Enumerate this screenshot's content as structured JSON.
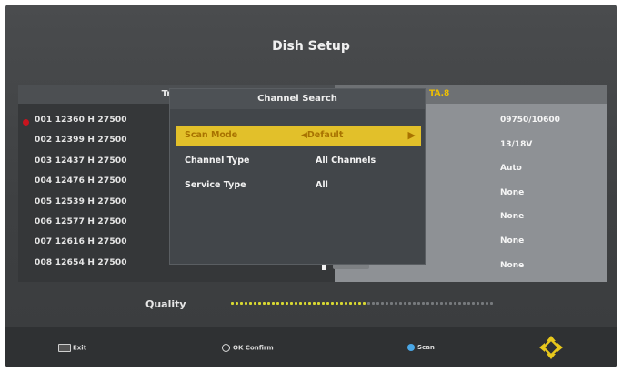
{
  "screen": {
    "title": "Dish Setup"
  },
  "transponder_panel": {
    "header": "Transf",
    "rows": [
      "001 12360 H 27500",
      "002 12399 H 27500",
      "003 12437 H 27500",
      "004 12476 H 27500",
      "005 12539 H 27500",
      "006 12577 H 27500",
      "007 12616 H 27500",
      "008 12654 H 27500"
    ]
  },
  "settings_panel": {
    "header_fragment": "TA.8",
    "values": [
      "09750/10600",
      "13/18V",
      "Auto",
      "None",
      "None",
      "None",
      "None"
    ],
    "last_value": "None"
  },
  "dialog": {
    "title": "Channel Search",
    "options": [
      {
        "label": "Scan Mode",
        "value": "Default",
        "selected": true
      },
      {
        "label": "Channel Type",
        "value": "All Channels",
        "selected": false
      },
      {
        "label": "Service Type",
        "value": "All",
        "selected": false
      }
    ],
    "left_arrow": "◀",
    "right_arrow": "▶"
  },
  "quality": {
    "label": "Quality",
    "level": 0.52,
    "fill_color": "#d8d832",
    "empty_color": "#777a7d"
  },
  "footer": {
    "exit_label": "Exit",
    "ok_label": "OK Confirm",
    "scan_label": "Scan"
  },
  "colors": {
    "highlight": "#e2c02a",
    "nav_icon": "#e8c81c",
    "scan_icon": "#4aa7e6",
    "bullet": "#c8141e"
  }
}
